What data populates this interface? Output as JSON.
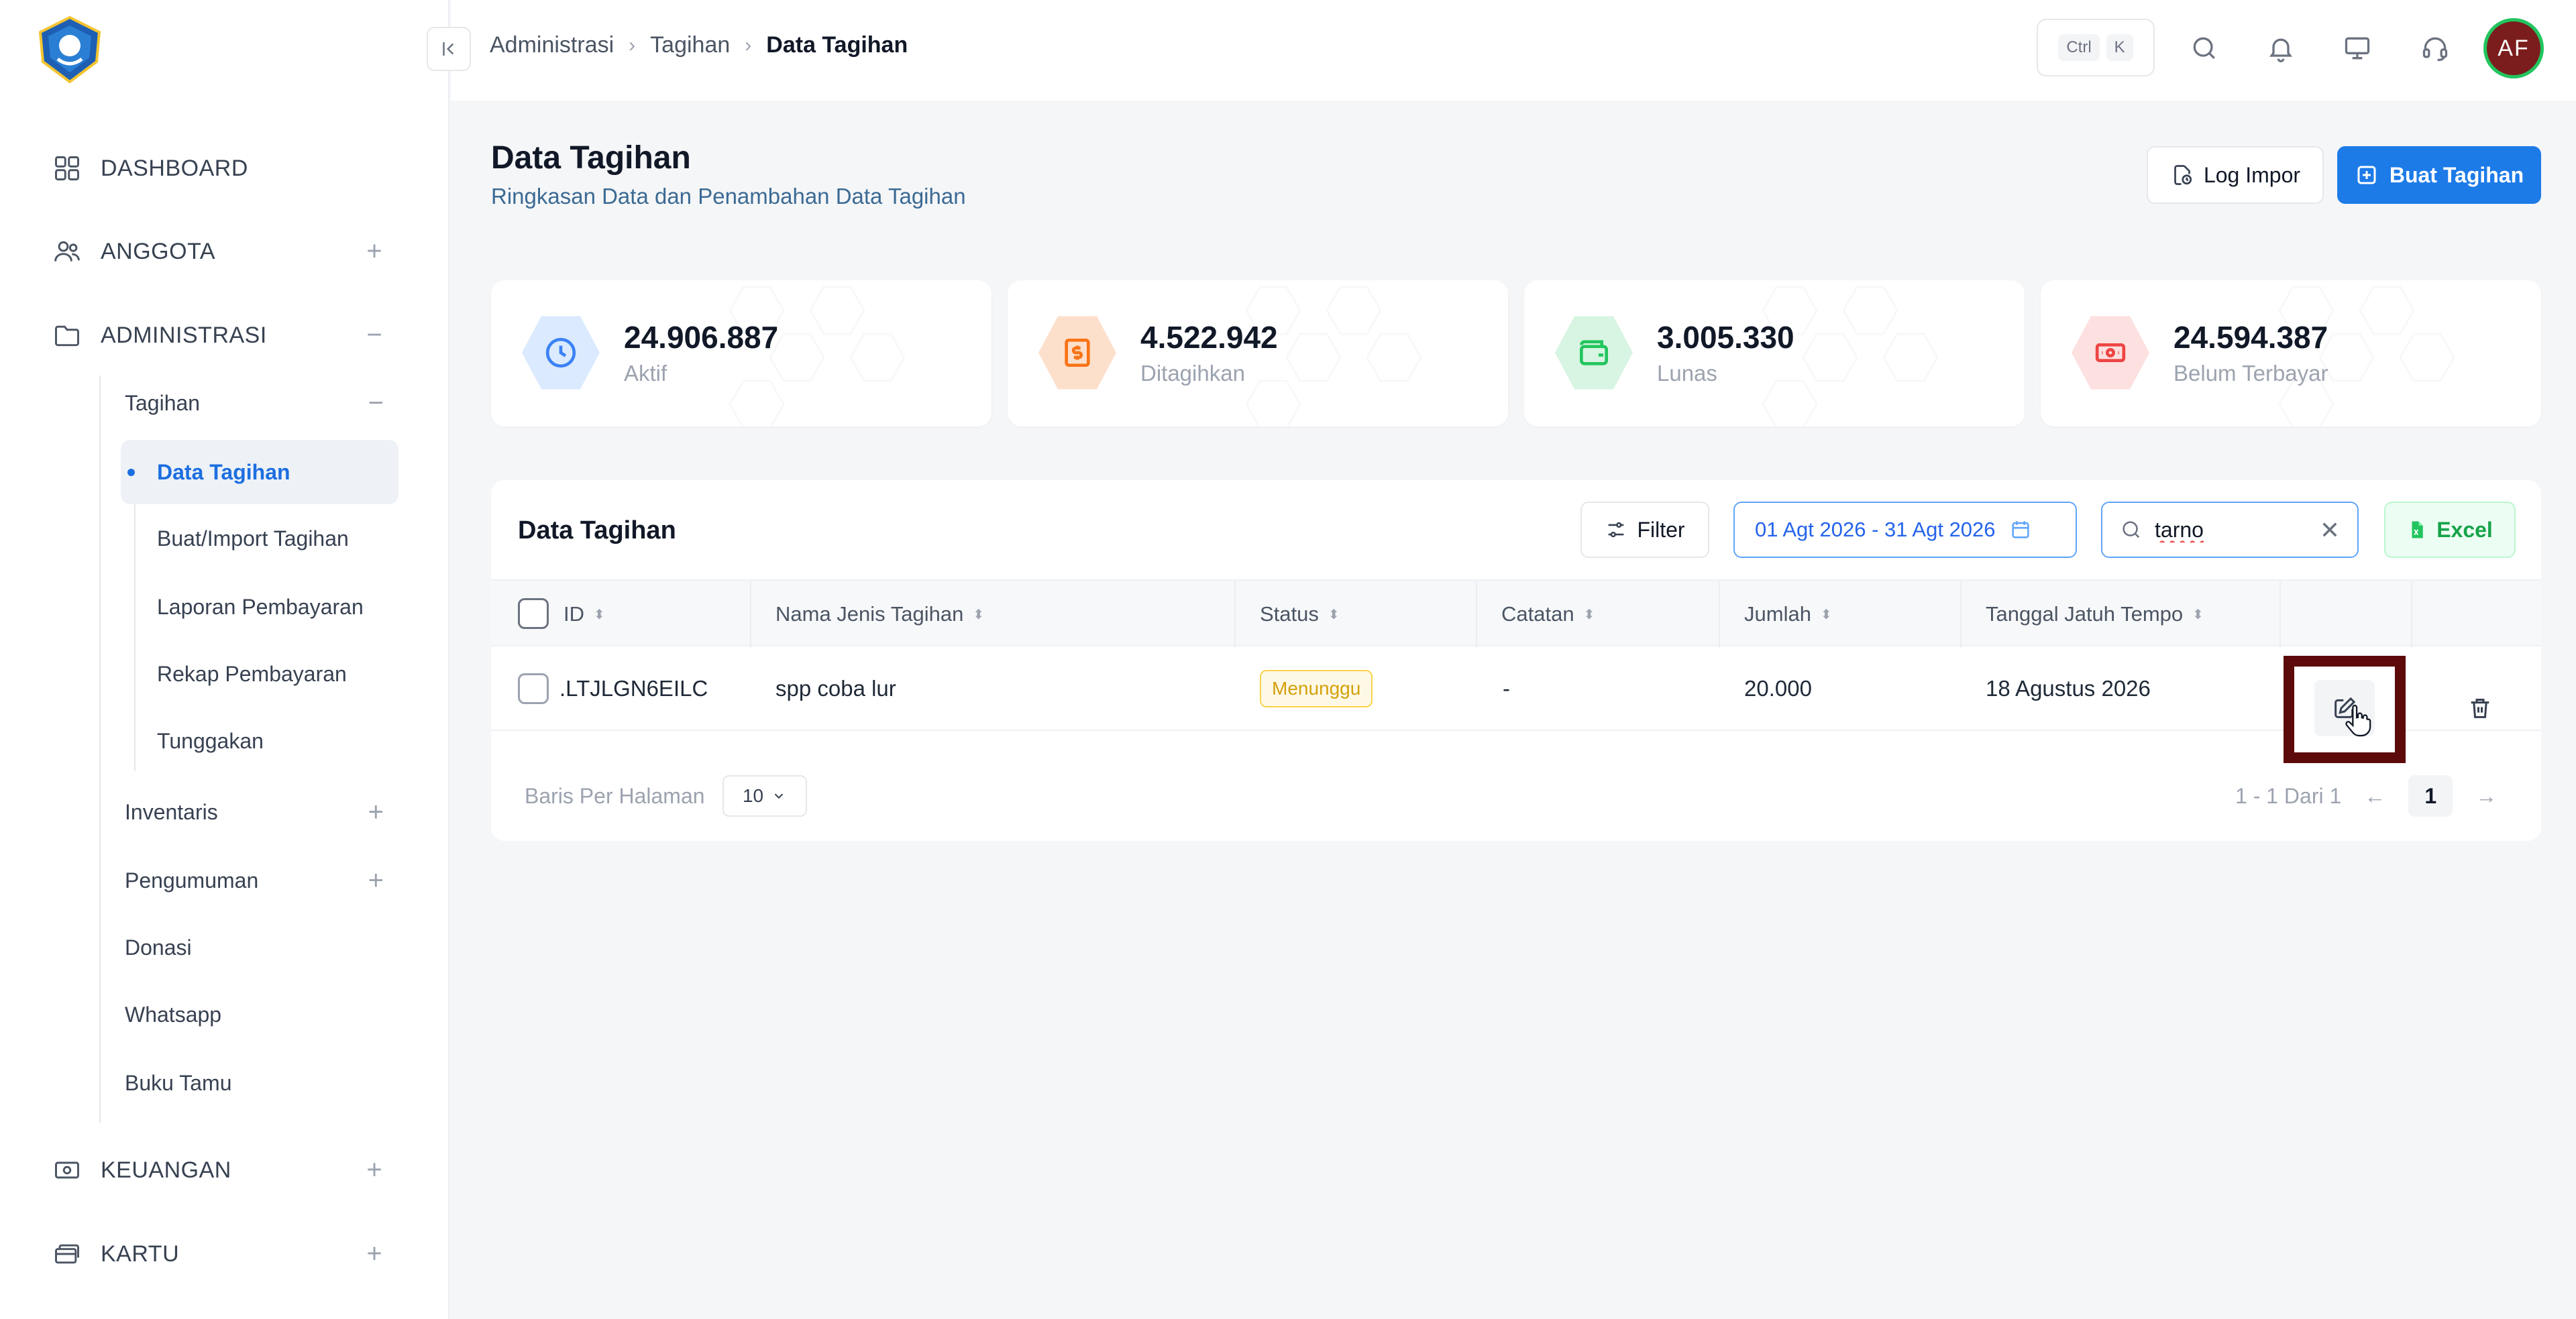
{
  "sidebar": {
    "top_items": [
      {
        "label": "DASHBOARD",
        "icon": "grid-icon",
        "toggle": ""
      },
      {
        "label": "ANGGOTA",
        "icon": "users-icon",
        "toggle": "+"
      },
      {
        "label": "ADMINISTRASI",
        "icon": "folder-icon",
        "toggle": "−"
      },
      {
        "label": "KEUANGAN",
        "icon": "money-icon",
        "toggle": "+"
      },
      {
        "label": "KARTU",
        "icon": "card-icon",
        "toggle": "+"
      }
    ],
    "tagihan": {
      "label": "Tagihan",
      "toggle": "−"
    },
    "tagihan_items": [
      "Data Tagihan",
      "Buat/Import Tagihan",
      "Laporan Pembayaran",
      "Rekap Pembayaran",
      "Tunggakan"
    ],
    "admin_items": [
      {
        "label": "Inventaris",
        "toggle": "+"
      },
      {
        "label": "Pengumuman",
        "toggle": "+"
      },
      {
        "label": "Donasi",
        "toggle": ""
      },
      {
        "label": "Whatsapp",
        "toggle": ""
      },
      {
        "label": "Buku Tamu",
        "toggle": ""
      }
    ]
  },
  "header": {
    "breadcrumb": [
      "Administrasi",
      "Tagihan",
      "Data Tagihan"
    ],
    "shortcut": [
      "Ctrl",
      "K"
    ],
    "avatar": "AF"
  },
  "page": {
    "title": "Data Tagihan",
    "subtitle": "Ringkasan Data dan Penambahan Data Tagihan",
    "log_button": "Log Impor",
    "create_button": "Buat Tagihan"
  },
  "stats": [
    {
      "value": "24.906.887",
      "label": "Aktif",
      "color": "#3b82f6",
      "bg": "#dbeafe",
      "icon": "clock-icon"
    },
    {
      "value": "4.522.942",
      "label": "Ditagihkan",
      "color": "#f97316",
      "bg": "#fde0cc",
      "icon": "dollar-icon"
    },
    {
      "value": "3.005.330",
      "label": "Lunas",
      "color": "#22c55e",
      "bg": "#d7f5e2",
      "icon": "wallet-icon"
    },
    {
      "value": "24.594.387",
      "label": "Belum Terbayar",
      "color": "#ef4444",
      "bg": "#fde0e0",
      "icon": "cash-icon"
    }
  ],
  "table": {
    "title": "Data Tagihan",
    "filter_label": "Filter",
    "date_range": "01 Agt 2026 - 31 Agt 2026",
    "search_value": "tarno",
    "excel_label": "Excel",
    "columns": [
      "ID",
      "Nama Jenis Tagihan",
      "Status",
      "Catatan",
      "Jumlah",
      "Tanggal Jatuh Tempo"
    ],
    "rows": [
      {
        "id": ".LTJLGN6EILC",
        "nama": "spp coba lur",
        "status": "Menunggu",
        "catatan": "-",
        "jumlah": "20.000",
        "jatuh_tempo": "18 Agustus 2026"
      }
    ],
    "rows_per_page_label": "Baris Per Halaman",
    "rows_per_page": "10",
    "range_text": "1 - 1 Dari 1",
    "current_page": "1"
  }
}
